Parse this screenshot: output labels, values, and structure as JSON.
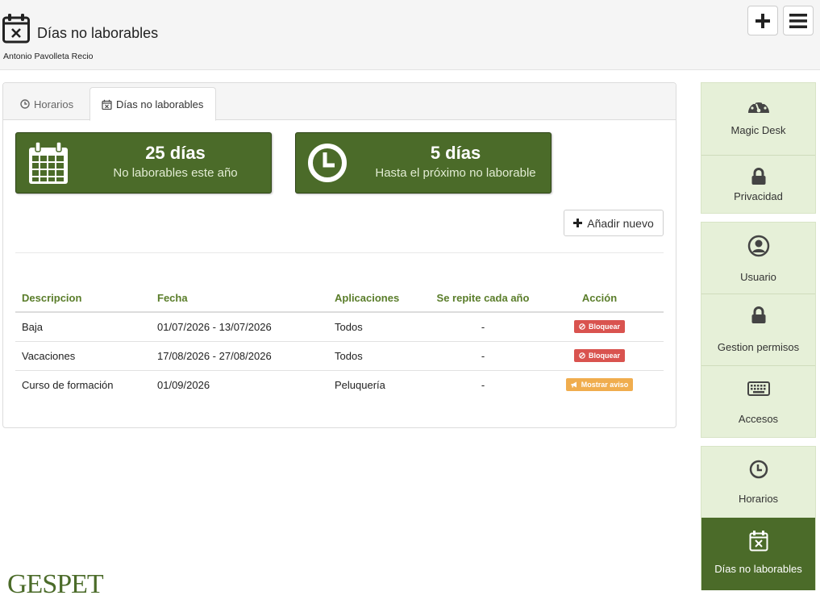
{
  "header": {
    "title": "Días no laborables",
    "subtitle": "Antonio Pavolleta Recio",
    "page_icon": "calendar-x-icon",
    "add_icon": "plus-icon",
    "menu_icon": "hamburger-menu-icon"
  },
  "tabs": [
    {
      "label": "Horarios",
      "icon": "clock-icon",
      "active": false
    },
    {
      "label": "Días no laborables",
      "icon": "calendar-x-icon",
      "active": true
    }
  ],
  "stats": [
    {
      "value": "25 días",
      "label": "No laborables este año",
      "icon": "calendar-icon"
    },
    {
      "value": "5 días",
      "label": "Hasta el próximo no laborable",
      "icon": "clock-icon"
    }
  ],
  "add_button": {
    "label": "Añadir nuevo",
    "icon": "plus-icon"
  },
  "table": {
    "headers": [
      "Descripcion",
      "Fecha",
      "Aplicaciones",
      "Se repite cada año",
      "Acción"
    ],
    "rows": [
      {
        "descripcion": "Baja",
        "fecha": "01/07/2026 - 13/07/2026",
        "aplicaciones": "Todos",
        "repite": "-",
        "accion": "Bloquear",
        "accion_icon": "ban-icon",
        "accion_color": "#d9534f"
      },
      {
        "descripcion": "Vacaciones",
        "fecha": "17/08/2026 - 27/08/2026",
        "aplicaciones": "Todos",
        "repite": "-",
        "accion": "Bloquear",
        "accion_icon": "ban-icon",
        "accion_color": "#d9534f"
      },
      {
        "descripcion": "Curso de formación",
        "fecha": "01/09/2026",
        "aplicaciones": "Peluquería",
        "repite": "-",
        "accion": "Mostrar aviso",
        "accion_icon": "megaphone-icon",
        "accion_color": "#f0ad4e"
      }
    ]
  },
  "sidebar": {
    "items": [
      {
        "label": "Magic Desk",
        "icon": "dashboard-icon"
      },
      {
        "label": "Privacidad",
        "icon": "lock-icon"
      },
      {
        "label": "Usuario",
        "icon": "user-circle-icon"
      },
      {
        "label": "Gestion permisos",
        "icon": "lock-icon"
      },
      {
        "label": "Accesos",
        "icon": "keyboard-icon"
      },
      {
        "label": "Horarios",
        "icon": "clock-icon"
      },
      {
        "label": "Días no laborables",
        "icon": "calendar-x-icon",
        "active": true
      }
    ]
  },
  "logo": "GESPET",
  "colors": {
    "brand_green": "#4b6b29",
    "sidebar_bg": "#e6f0d8",
    "header_green_text": "#5a7d2a",
    "danger": "#d9534f",
    "warning": "#f0ad4e"
  }
}
